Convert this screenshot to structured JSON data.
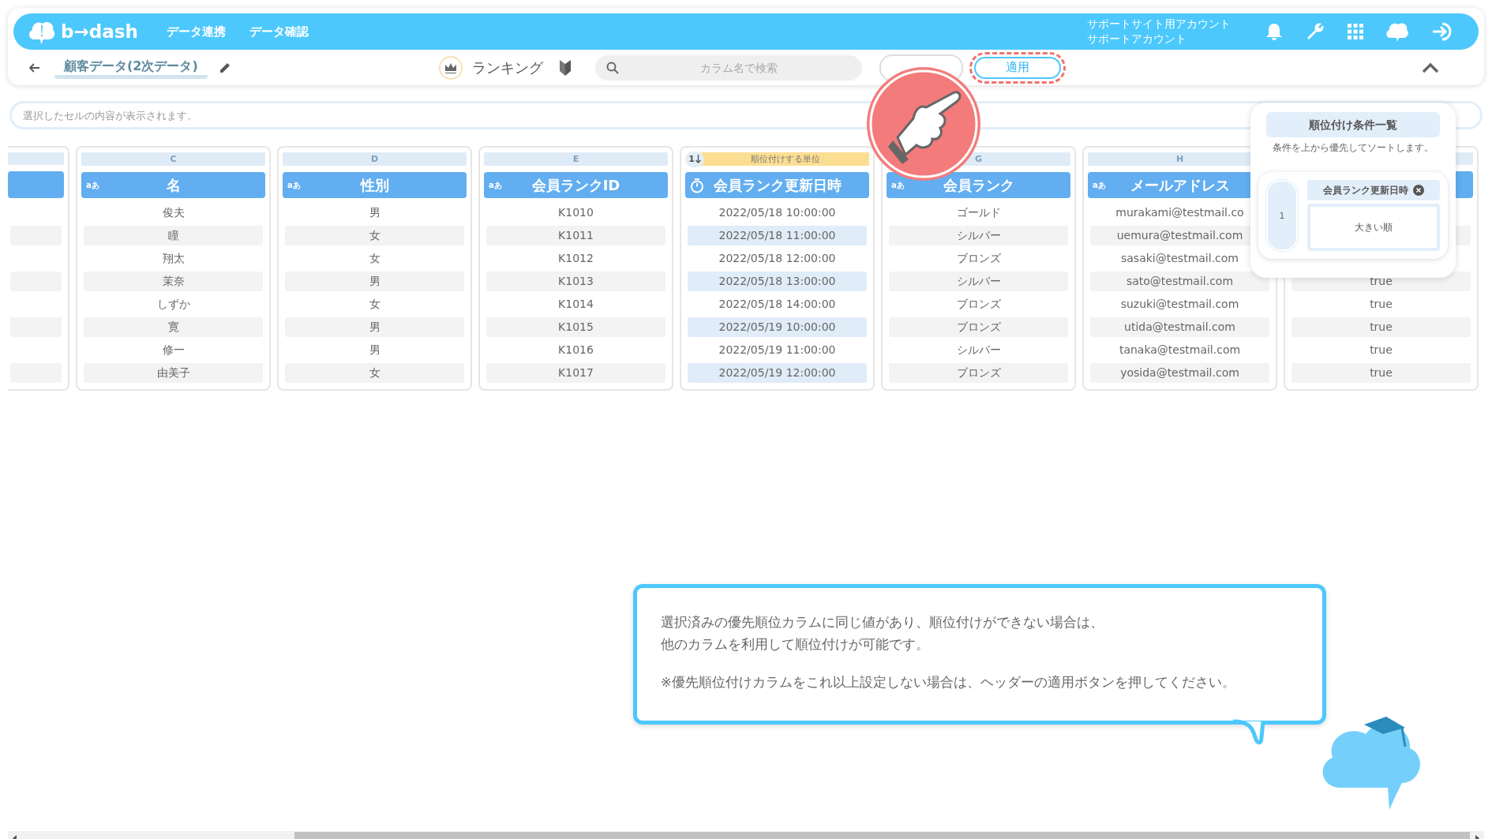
{
  "header": {
    "logo": "b→dash",
    "nav": [
      {
        "label": "データ連携"
      },
      {
        "label": "データ確認"
      }
    ],
    "account": [
      "サポートサイト用アカウント",
      "サポートアカウント"
    ]
  },
  "toolbar": {
    "title": "顧客データ(2次データ)",
    "mode": "ランキング",
    "search": {
      "placeholder": "カラム名で検索"
    },
    "apply_button": {
      "label": "適用",
      "highlighted": true
    }
  },
  "cell_field": {
    "placeholder": "選択したセルの内容が表示されます。"
  },
  "columns": [
    {
      "kind": "stub"
    },
    {
      "kind": "column",
      "letter": "C",
      "type_label": "aあ",
      "title": "名",
      "highlighted": false,
      "rows": [
        "俊夫",
        "瞳",
        "翔太",
        "茉奈",
        "しずか",
        "寛",
        "修一",
        "由美子"
      ]
    },
    {
      "kind": "column",
      "letter": "D",
      "type_label": "aあ",
      "title": "性別",
      "highlighted": false,
      "rows": [
        "男",
        "女",
        "女",
        "男",
        "女",
        "男",
        "男",
        "女"
      ]
    },
    {
      "kind": "column",
      "letter": "E",
      "type_label": "aあ",
      "title": "会員ランクID",
      "highlighted": false,
      "rows": [
        "K1010",
        "K1011",
        "K1012",
        "K1013",
        "K1014",
        "K1015",
        "K1016",
        "K1017"
      ]
    },
    {
      "kind": "column",
      "timer": true,
      "title": "会員ランク更新日時",
      "rank": "1",
      "sort_label": "順位付けする単位",
      "highlighted": true,
      "rows": [
        "2022/05/18 10:00:00",
        "2022/05/18 11:00:00",
        "2022/05/18 12:00:00",
        "2022/05/18 13:00:00",
        "2022/05/18 14:00:00",
        "2022/05/19 10:00:00",
        "2022/05/19 11:00:00",
        "2022/05/19 12:00:00"
      ]
    },
    {
      "kind": "column",
      "letter": "G",
      "type_label": "aあ",
      "title": "会員ランク",
      "highlighted": false,
      "rows": [
        "ゴールド",
        "シルバー",
        "ブロンズ",
        "シルバー",
        "ブロンズ",
        "ブロンズ",
        "シルバー",
        "ブロンズ"
      ]
    },
    {
      "kind": "column",
      "letter": "H",
      "type_label": "aあ",
      "title": "メールアドレス",
      "highlighted": false,
      "rows": [
        "murakami@testmail.co",
        "uemura@testmail.com",
        "sasaki@testmail.com",
        "sato@testmail.com",
        "suzuki@testmail.com",
        "utida@testmail.com",
        "tanaka@testmail.com",
        "yosida@testmail.com"
      ]
    },
    {
      "kind": "column",
      "highlighted": false,
      "rows": [
        null,
        null,
        null,
        "true",
        "true",
        "true",
        "true",
        "true"
      ]
    }
  ],
  "ranking_panel": {
    "title": "順位付け条件一覧",
    "description": "条件を上から優先してソートします。",
    "conditions": [
      {
        "number": "1",
        "column": "会員ランク更新日時",
        "order": "大きい順"
      }
    ]
  },
  "hint": {
    "paragraphs": [
      [
        "選択済みの優先順位カラムに同じ値があり、順位付けができない場合は、",
        "他のカラムを利用して順位付けが可能です。"
      ],
      [
        "※優先順位付けカラムをこれ以上設定しない場合は、ヘッダーの適用ボタンを押してください。"
      ]
    ]
  }
}
